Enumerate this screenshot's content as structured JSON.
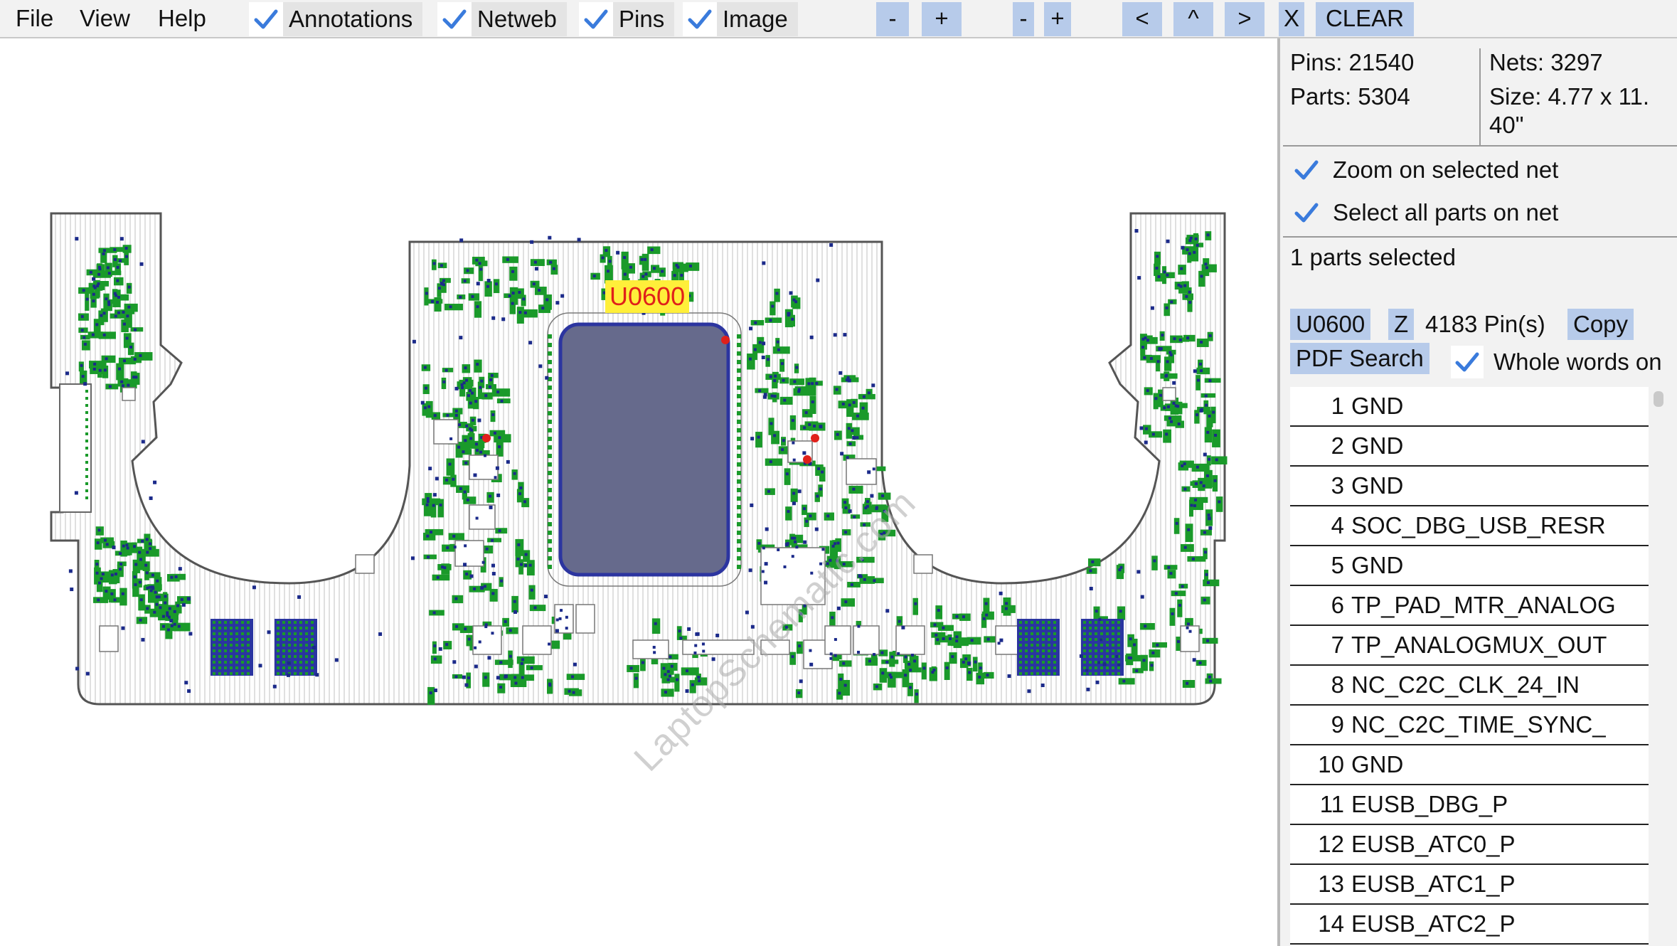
{
  "menu": {
    "file": "File",
    "view": "View",
    "help": "Help"
  },
  "toggles": [
    {
      "label": "Annotations",
      "checked": true
    },
    {
      "label": "Netweb",
      "checked": true
    },
    {
      "label": "Pins",
      "checked": true
    },
    {
      "label": "Image",
      "checked": true
    }
  ],
  "toolbar": {
    "zoom_out_1": "-",
    "zoom_in_1": "+",
    "zoom_out_2": "-",
    "zoom_in_2": "+",
    "prev": "<",
    "up": "^",
    "next": ">",
    "close": "X",
    "clear": "CLEAR"
  },
  "board": {
    "selected_part_tag": "U0600",
    "watermark": "LaptopSchematic.com",
    "colors": {
      "board_outline": "#555555",
      "trace": "#cfcfcf",
      "pad": "#1a9a2a",
      "pin": "#1b2a8a",
      "soc": "#666a8c",
      "highlight": "#ffef3a"
    }
  },
  "stats": {
    "pins": "Pins: 21540",
    "nets": "Nets: 3297",
    "parts": "Parts: 5304",
    "size_line1": "Size: 4.77 x 11.",
    "size_line2": "40\""
  },
  "options": {
    "zoom_on_selected_net": "Zoom on selected net",
    "select_all_parts_on_net": "Select all parts on net"
  },
  "selection": {
    "status": "1 parts selected",
    "part": "U0600",
    "z_button": "Z",
    "pin_count": "4183 Pin(s)",
    "copy_button": "Copy",
    "pdf_search_button": "PDF Search",
    "whole_words": "Whole words on"
  },
  "pins": [
    {
      "num": "1",
      "net": "GND"
    },
    {
      "num": "2",
      "net": "GND"
    },
    {
      "num": "3",
      "net": "GND"
    },
    {
      "num": "4",
      "net": "SOC_DBG_USB_RESR"
    },
    {
      "num": "5",
      "net": "GND"
    },
    {
      "num": "6",
      "net": "TP_PAD_MTR_ANALOG"
    },
    {
      "num": "7",
      "net": "TP_ANALOGMUX_OUT"
    },
    {
      "num": "8",
      "net": "NC_C2C_CLK_24_IN"
    },
    {
      "num": "9",
      "net": "NC_C2C_TIME_SYNC_"
    },
    {
      "num": "10",
      "net": "GND"
    },
    {
      "num": "11",
      "net": "EUSB_DBG_P"
    },
    {
      "num": "12",
      "net": "EUSB_ATC0_P"
    },
    {
      "num": "13",
      "net": "EUSB_ATC1_P"
    },
    {
      "num": "14",
      "net": "EUSB_ATC2_P"
    }
  ]
}
